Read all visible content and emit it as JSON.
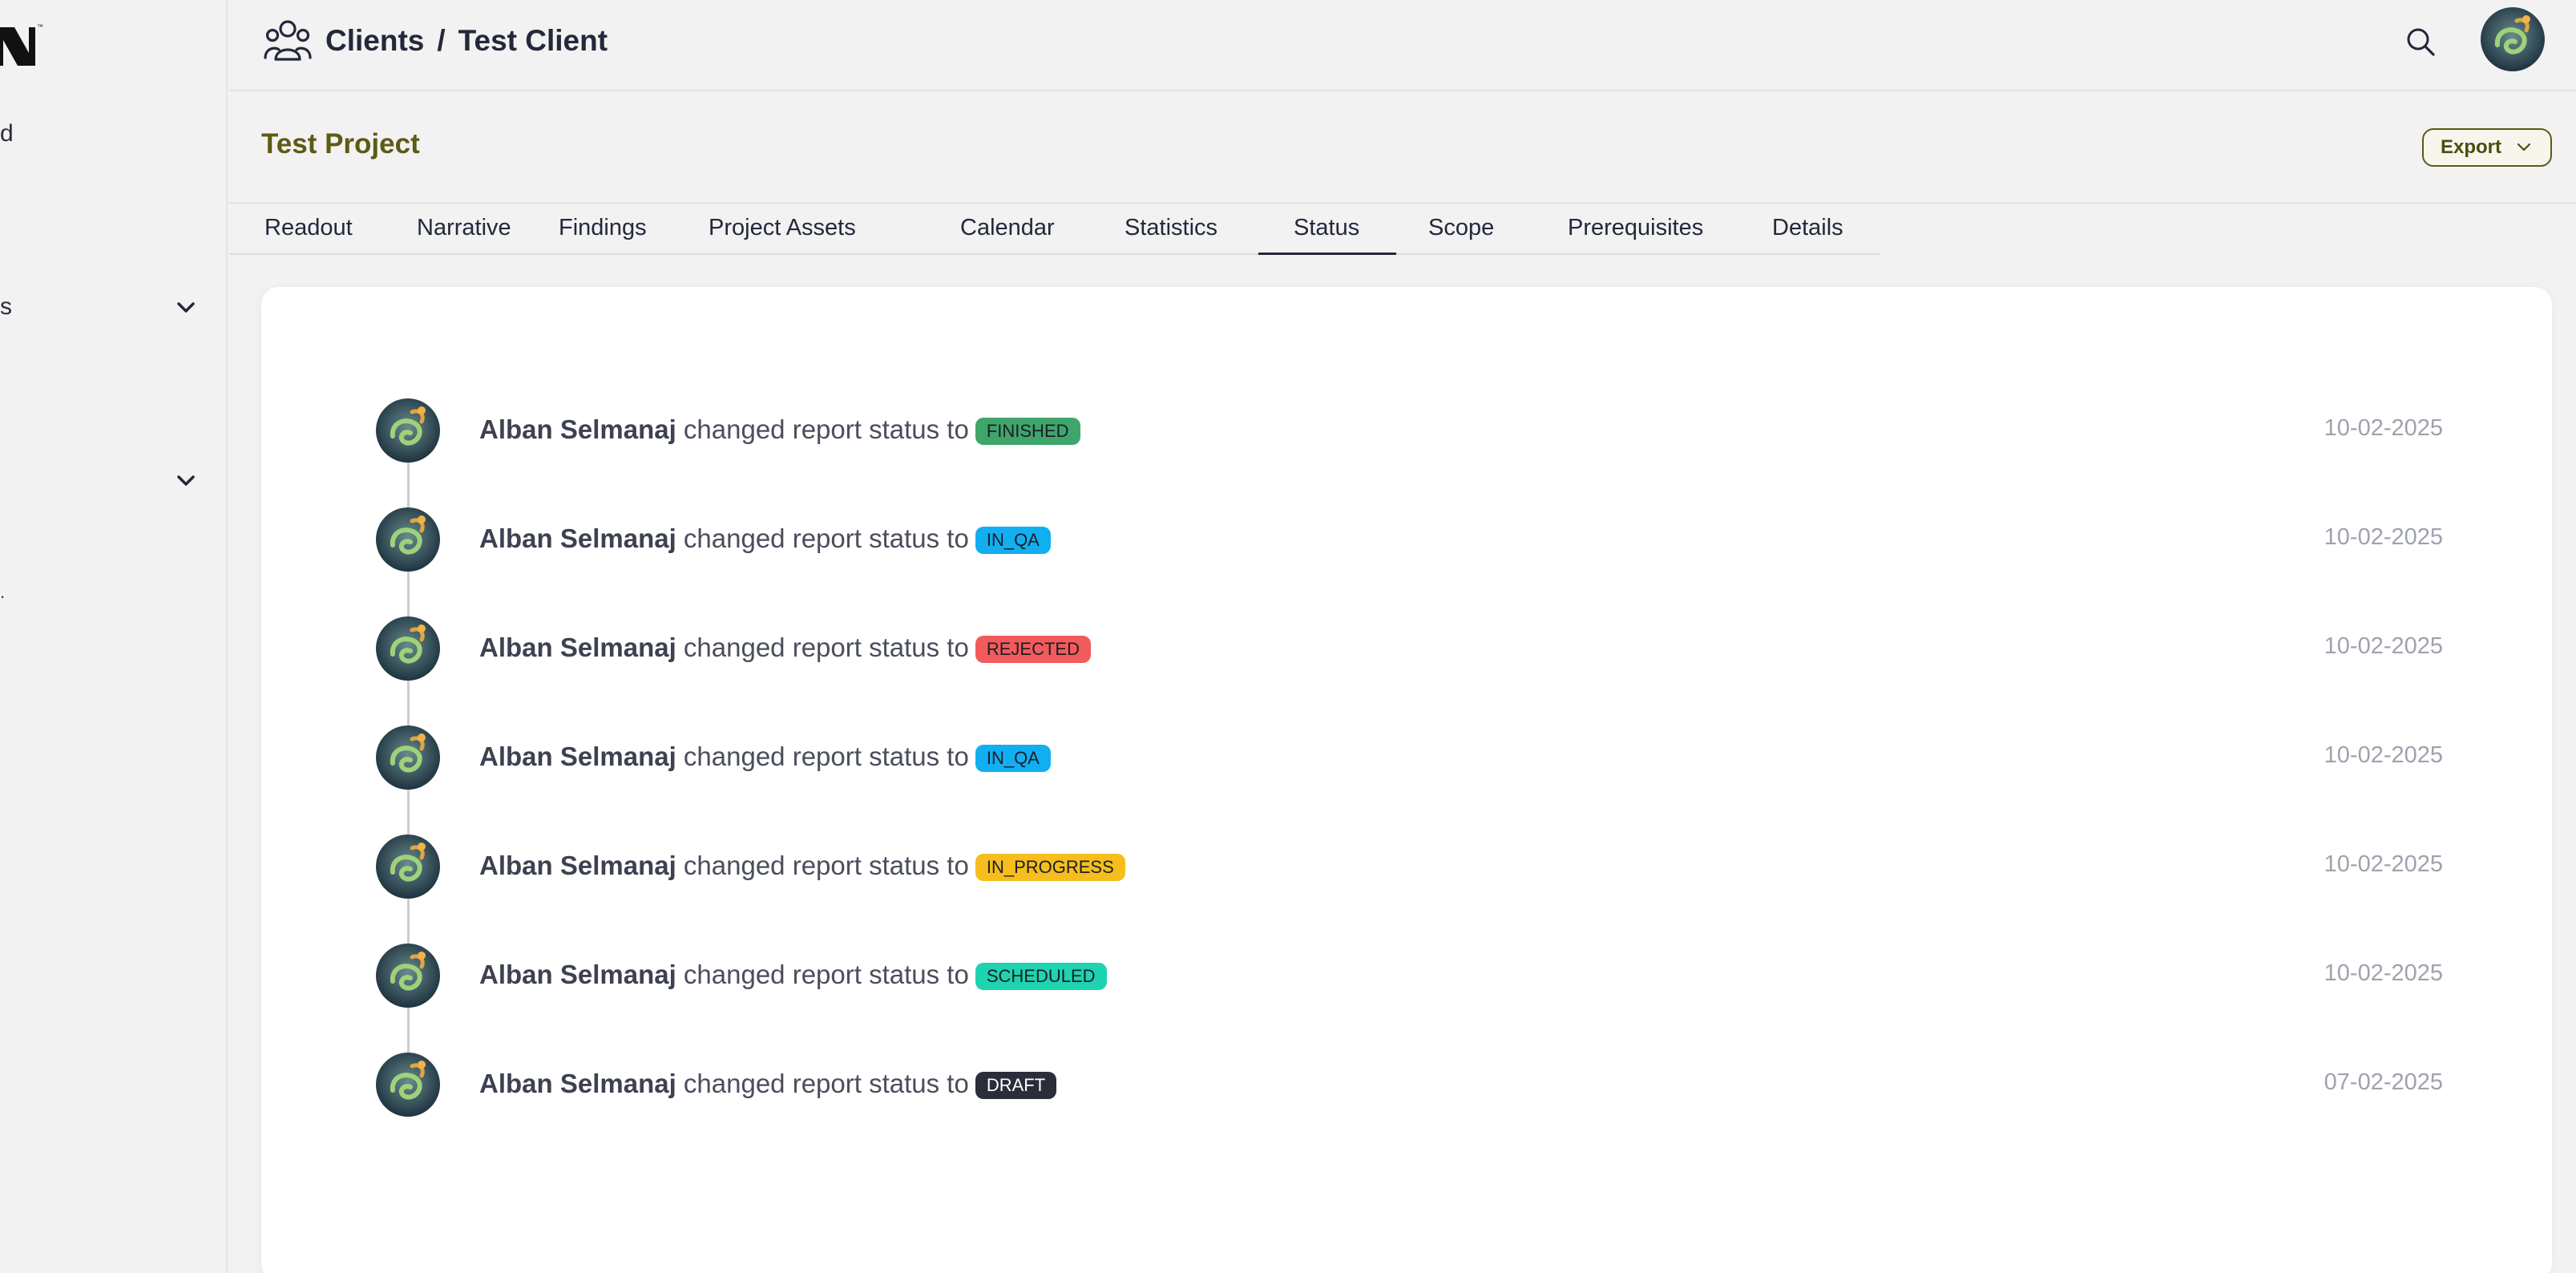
{
  "sidebar": {
    "items": [
      {
        "label": "d"
      },
      {
        "label": "s"
      },
      {
        "label": "."
      }
    ]
  },
  "breadcrumb": {
    "parent": "Clients",
    "separator": "/",
    "current": "Test Client"
  },
  "project": {
    "title": "Test Project",
    "export_label": "Export"
  },
  "tabs": [
    {
      "label": "Readout"
    },
    {
      "label": "Narrative"
    },
    {
      "label": "Findings"
    },
    {
      "label": "Project Assets"
    },
    {
      "label": "Calendar"
    },
    {
      "label": "Statistics"
    },
    {
      "label": "Status",
      "active": true
    },
    {
      "label": "Scope"
    },
    {
      "label": "Prerequisites"
    },
    {
      "label": "Details"
    }
  ],
  "status_colors": {
    "FINISHED": "#3fa56a",
    "IN_QA": "#12aef2",
    "REJECTED": "#f25b5b",
    "IN_PROGRESS": "#f5be1c",
    "SCHEDULED": "#1ed3b0",
    "DRAFT": "#2a2e3a"
  },
  "history": [
    {
      "user": "Alban Selmanaj",
      "action": "changed report status to",
      "status": "FINISHED",
      "date": "10-02-2025"
    },
    {
      "user": "Alban Selmanaj",
      "action": "changed report status to",
      "status": "IN_QA",
      "date": "10-02-2025"
    },
    {
      "user": "Alban Selmanaj",
      "action": "changed report status to",
      "status": "REJECTED",
      "date": "10-02-2025"
    },
    {
      "user": "Alban Selmanaj",
      "action": "changed report status to",
      "status": "IN_QA",
      "date": "10-02-2025"
    },
    {
      "user": "Alban Selmanaj",
      "action": "changed report status to",
      "status": "IN_PROGRESS",
      "date": "10-02-2025"
    },
    {
      "user": "Alban Selmanaj",
      "action": "changed report status to",
      "status": "SCHEDULED",
      "date": "10-02-2025"
    },
    {
      "user": "Alban Selmanaj",
      "action": "changed report status to",
      "status": "DRAFT",
      "date": "07-02-2025"
    }
  ],
  "icons": {
    "clients": "users-group-icon",
    "search": "search-icon",
    "export_caret": "chevron-down-icon",
    "sidebar_caret": "chevron-down-icon"
  }
}
